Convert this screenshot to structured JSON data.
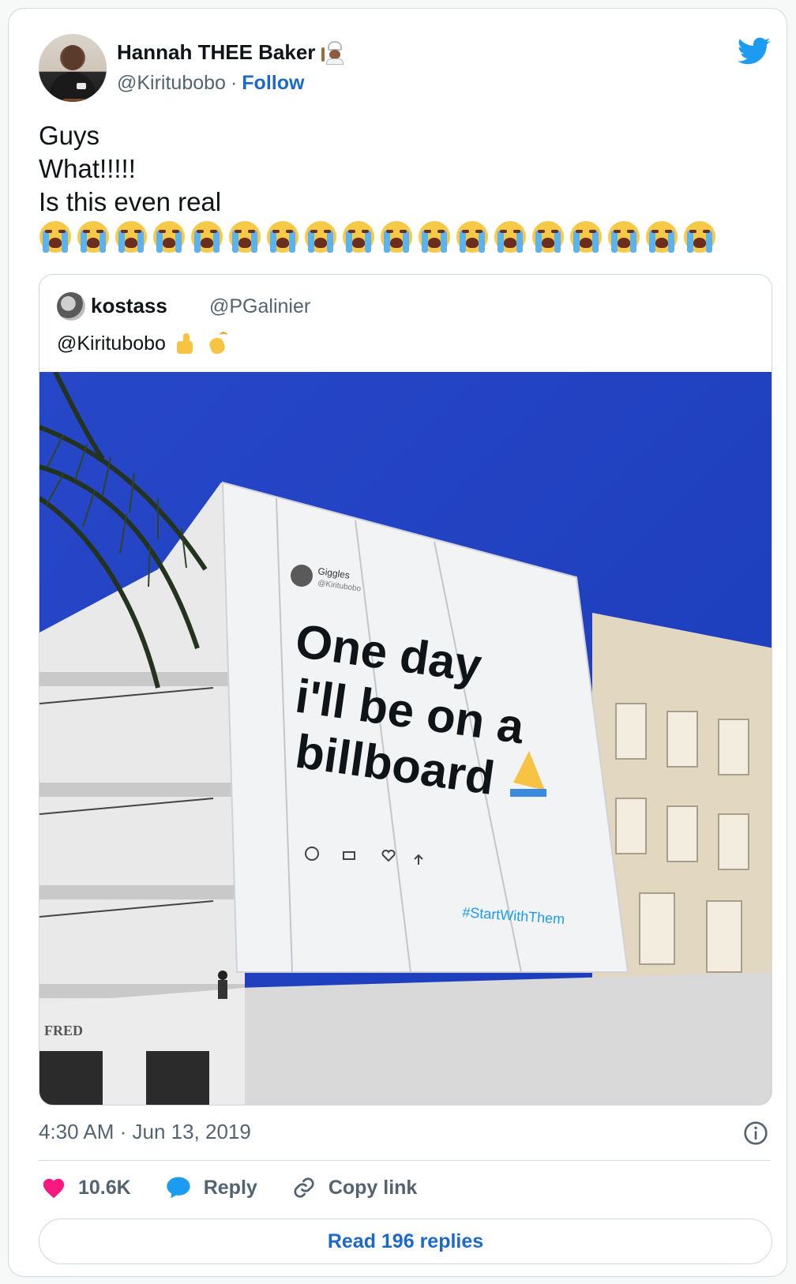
{
  "author": {
    "name": "Hannah THEE Baker",
    "handle": "@Kiritubobo",
    "separator": "·",
    "follow_label": "Follow",
    "name_emoji": "chef-icon"
  },
  "tweet": {
    "lines": [
      "Guys",
      "What!!!!!",
      "Is this even real"
    ],
    "emoji": "loudly-crying-face-icon",
    "emoji_count": 18
  },
  "quote": {
    "name": "kostass",
    "handle": "@PGalinier",
    "text": "@Kiritubobo",
    "emojis": [
      "thumbs-up-icon",
      "clapping-hands-icon"
    ],
    "billboard": {
      "account_name": "Giggles",
      "account_handle": "@Kiritubobo",
      "headline_lines": [
        "One day",
        "i'll be on a",
        "billboard"
      ],
      "hashtag": "#StartWithThem",
      "storefront": "FRED"
    }
  },
  "meta": {
    "timestamp": "4:30 AM · Jun 13, 2019"
  },
  "actions": {
    "likes": "10.6K",
    "reply_label": "Reply",
    "copy_label": "Copy link",
    "read_replies_label": "Read 196 replies"
  },
  "colors": {
    "link_blue": "#1d69c9",
    "twitter_blue": "#1d9bf0",
    "like_pink": "#f91880",
    "muted": "#536471",
    "sky": "#1f3fbf"
  }
}
